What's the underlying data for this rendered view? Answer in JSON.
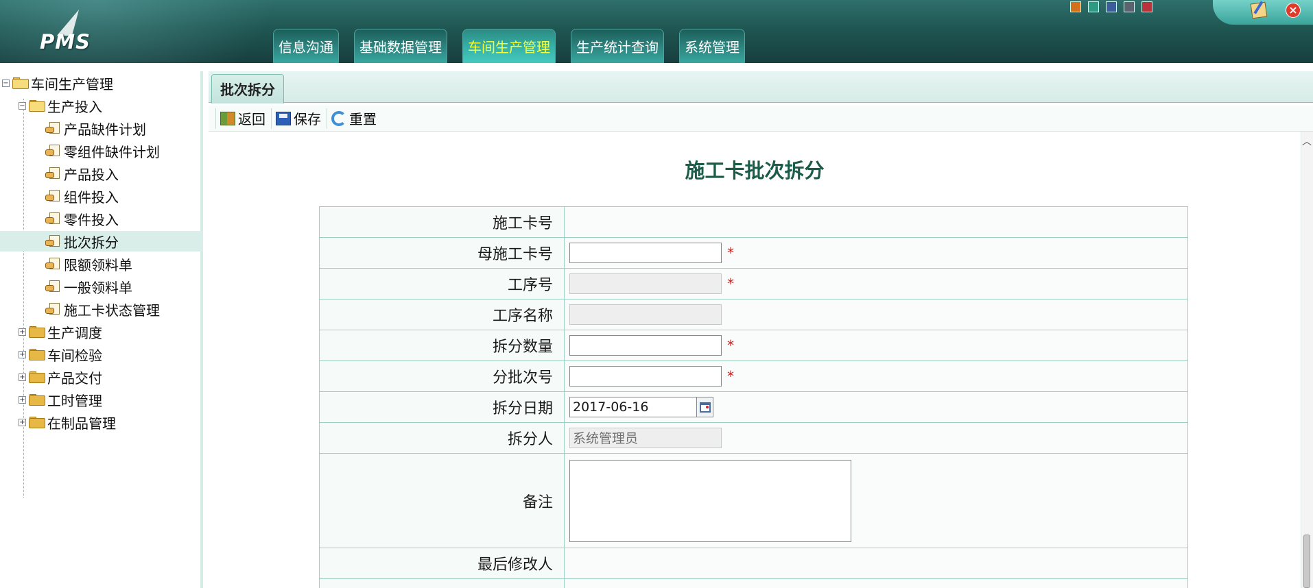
{
  "header": {
    "logo_text": "PMS",
    "nav": [
      {
        "label": "信息沟通",
        "active": false
      },
      {
        "label": "基础数据管理",
        "active": false
      },
      {
        "label": "车间生产管理",
        "active": true
      },
      {
        "label": "生产统计查询",
        "active": false
      },
      {
        "label": "系统管理",
        "active": false
      }
    ],
    "theme_colors": [
      "#d2701e",
      "#2e9a83",
      "#3c5c9a",
      "#5d6270",
      "#b8343a"
    ]
  },
  "sidebar": {
    "root": "车间生产管理",
    "group_open": "生产投入",
    "leaves": [
      "产品缺件计划",
      "零组件缺件计划",
      "产品投入",
      "组件投入",
      "零件投入",
      "批次拆分",
      "限额领料单",
      "一般领料单",
      "施工卡状态管理"
    ],
    "selected_leaf": "批次拆分",
    "groups_closed": [
      "生产调度",
      "车间检验",
      "产品交付",
      "工时管理",
      "在制品管理"
    ]
  },
  "tab": {
    "label": "批次拆分"
  },
  "toolbar": {
    "back": "返回",
    "save": "保存",
    "reset": "重置"
  },
  "form": {
    "title": "施工卡批次拆分",
    "required_mark": "*",
    "fields": {
      "card_no": {
        "label": "施工卡号",
        "value": ""
      },
      "parent_card_no": {
        "label": "母施工卡号",
        "value": ""
      },
      "process_no": {
        "label": "工序号",
        "value": ""
      },
      "process_name": {
        "label": "工序名称",
        "value": ""
      },
      "split_qty": {
        "label": "拆分数量",
        "value": ""
      },
      "batch_no": {
        "label": "分批次号",
        "value": ""
      },
      "split_date": {
        "label": "拆分日期",
        "value": "2017-06-16"
      },
      "splitter": {
        "label": "拆分人",
        "value": "系统管理员"
      },
      "remark": {
        "label": "备注",
        "value": ""
      },
      "last_modifier": {
        "label": "最后修改人",
        "value": ""
      }
    }
  }
}
